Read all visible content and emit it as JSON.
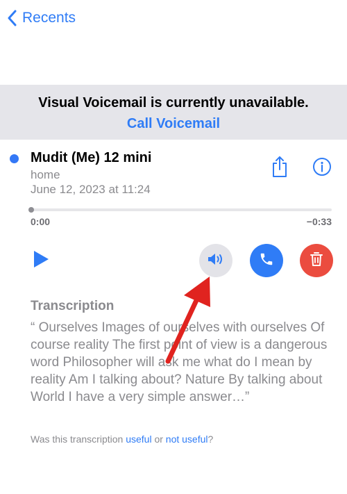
{
  "nav": {
    "back_label": "Recents"
  },
  "banner": {
    "message": "Visual Voicemail is currently unavailable.",
    "action": "Call Voicemail"
  },
  "voicemail": {
    "caller": "Mudit (Me) 12 mini",
    "label": "home",
    "date": "June 12, 2023 at 11:24",
    "elapsed": "0:00",
    "remaining": "−0:33",
    "progress": 0
  },
  "transcription": {
    "title": "Transcription",
    "text": "“ Ourselves Images of ourselves with ourselves Of course reality The first point of view is a dangerous word Philosopher will ask me what do I mean by reality Am I talking about? Nature By talking about World I have a very simple answer…”"
  },
  "feedback": {
    "prefix": "Was this transcription ",
    "useful": "useful",
    "or": " or ",
    "not_useful": "not useful",
    "suffix": "?"
  },
  "colors": {
    "accent": "#2f7cf6",
    "delete": "#eb4c3f",
    "banner_bg": "#e5e5ea",
    "annotation_arrow": "#e0231f"
  },
  "icons": {
    "back": "chevron-left-icon",
    "share": "share-icon",
    "info": "info-icon",
    "play": "play-icon",
    "speaker": "speaker-icon",
    "call": "phone-icon",
    "delete": "trash-icon"
  }
}
